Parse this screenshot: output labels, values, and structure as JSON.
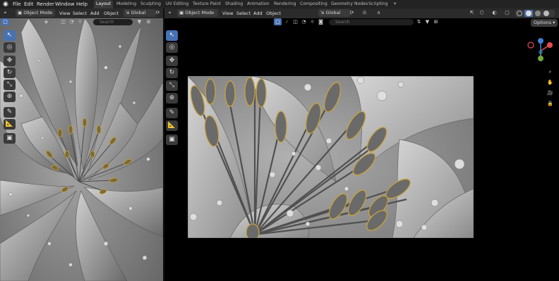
{
  "app": {
    "menus": [
      "File",
      "Edit",
      "Render",
      "Window",
      "Help"
    ],
    "workspace_tabs": [
      "Layout",
      "Modeling",
      "Sculpting",
      "UV Editing",
      "Texture Paint",
      "Shading",
      "Animation",
      "Rendering",
      "Compositing",
      "Geometry Nodes",
      "Scripting"
    ],
    "active_tab": "Layout",
    "add_tab_symbol": "+"
  },
  "left_editor": {
    "mode": "Object Mode",
    "menus": [
      "View",
      "Select",
      "Add",
      "Object"
    ],
    "orientation": "Global",
    "search_placeholder": "Search"
  },
  "right_editor": {
    "mode": "Object Mode",
    "menus": [
      "View",
      "Select",
      "Add",
      "Object"
    ],
    "orientation": "Global",
    "search_placeholder": "Search",
    "options_label": "Options"
  },
  "gizmo": {
    "axes": [
      "X",
      "Y",
      "Z"
    ],
    "colors": {
      "x": "#e84d4d",
      "y": "#6ea83a",
      "z": "#3f7fd9"
    }
  },
  "colors": {
    "accent": "#4772b3",
    "anther_gold": "#c9a23a",
    "background": "#1d1d1d"
  }
}
